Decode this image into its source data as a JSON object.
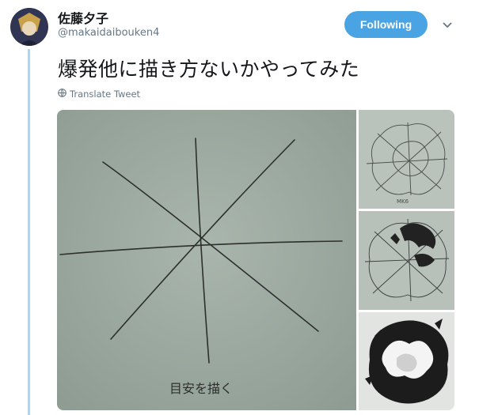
{
  "user": {
    "display_name": "佐藤夕子",
    "handle": "@makaidaibouken4"
  },
  "follow_button": {
    "label": "Following"
  },
  "tweet": {
    "text": "爆発他に描き方ないかやってみた",
    "translate_label": "Translate Tweet"
  },
  "media": {
    "main_photo": {
      "caption": "目安を描く"
    },
    "thumb1": {
      "caption": "MK6"
    }
  },
  "colors": {
    "accent": "#4aa3e3",
    "thread_line": "#a5d8f8",
    "paper": "#9aa89e"
  }
}
